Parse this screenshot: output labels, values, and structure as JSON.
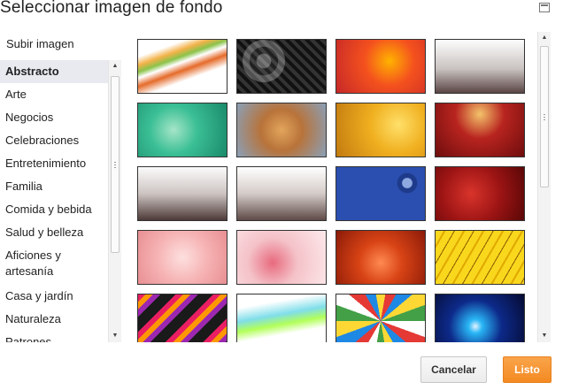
{
  "dialog": {
    "title": "Seleccionar imagen de fondo"
  },
  "upload": {
    "label": "Subir imagen"
  },
  "categories": [
    {
      "label": "Abstracto",
      "selected": true
    },
    {
      "label": "Arte"
    },
    {
      "label": "Negocios"
    },
    {
      "label": "Celebraciones"
    },
    {
      "label": "Entretenimiento"
    },
    {
      "label": "Familia"
    },
    {
      "label": "Comida y bebida"
    },
    {
      "label": "Salud y belleza"
    },
    {
      "label": "Aficiones y artesanía"
    },
    {
      "label": "Casa y jardín"
    },
    {
      "label": "Naturaleza"
    },
    {
      "label": "Patrones"
    }
  ],
  "thumbnails": {
    "count_visible": 20,
    "columns": 4
  },
  "footer": {
    "cancel_label": "Cancelar",
    "done_label": "Listo"
  },
  "colors": {
    "accent": "#f48a22",
    "selected_bg": "#e8eaf0"
  }
}
